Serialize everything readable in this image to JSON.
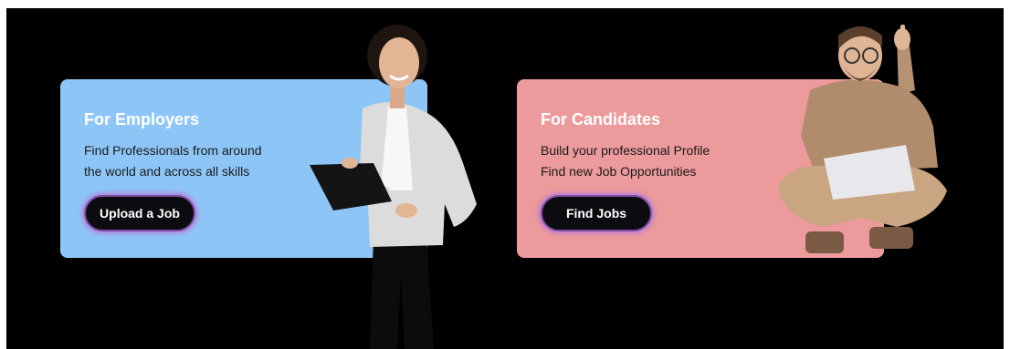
{
  "employers": {
    "title": "For Employers",
    "line1": "Find Professionals from around",
    "line2": "the world and across all skills",
    "button": "Upload a Job"
  },
  "candidates": {
    "title": "For Candidates",
    "line1": "Build your professional Profile",
    "line2": "Find new Job Opportunities",
    "button": "Find Jobs"
  },
  "colors": {
    "background": "#000000",
    "employers_card": "#8dc6f6",
    "candidates_card": "#ec9a9b",
    "button": "#0b0b10",
    "button_glow": "#b879d9"
  },
  "images": {
    "employers_person": "businesswoman-with-clipboard",
    "candidates_person": "man-with-laptop-pointing-up"
  }
}
